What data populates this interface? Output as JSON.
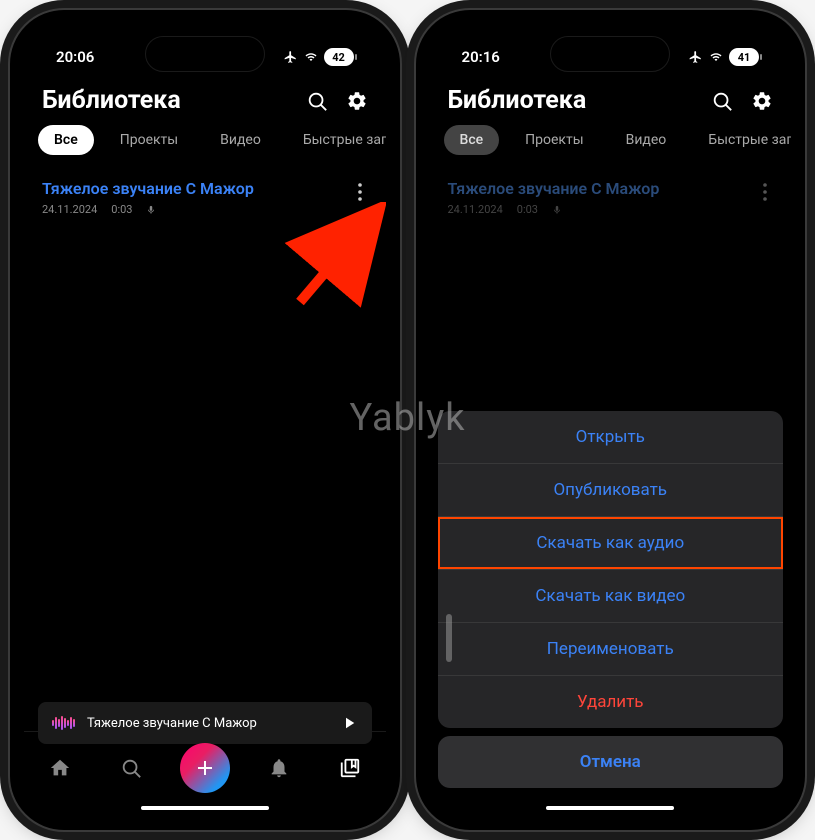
{
  "watermark": "Yablyk",
  "phone1": {
    "status_time": "20:06",
    "battery": "42",
    "header_title": "Библиотека",
    "tabs": [
      "Все",
      "Проекты",
      "Видео",
      "Быстрые записи"
    ],
    "item": {
      "title": "Тяжелое звучание С Мажор",
      "date": "24.11.2024",
      "duration": "0:03"
    },
    "now_playing": "Тяжелое звучание С Мажор"
  },
  "phone2": {
    "status_time": "20:16",
    "battery": "41",
    "header_title": "Библиотека",
    "tabs": [
      "Все",
      "Проекты",
      "Видео",
      "Быстрые записи"
    ],
    "item": {
      "title": "Тяжелое звучание С Мажор",
      "date": "24.11.2024",
      "duration": "0:03"
    },
    "sheet": {
      "open": "Открыть",
      "publish": "Опубликовать",
      "download_audio": "Скачать как аудио",
      "download_video": "Скачать как видео",
      "rename": "Переименовать",
      "delete": "Удалить",
      "cancel": "Отмена"
    }
  }
}
